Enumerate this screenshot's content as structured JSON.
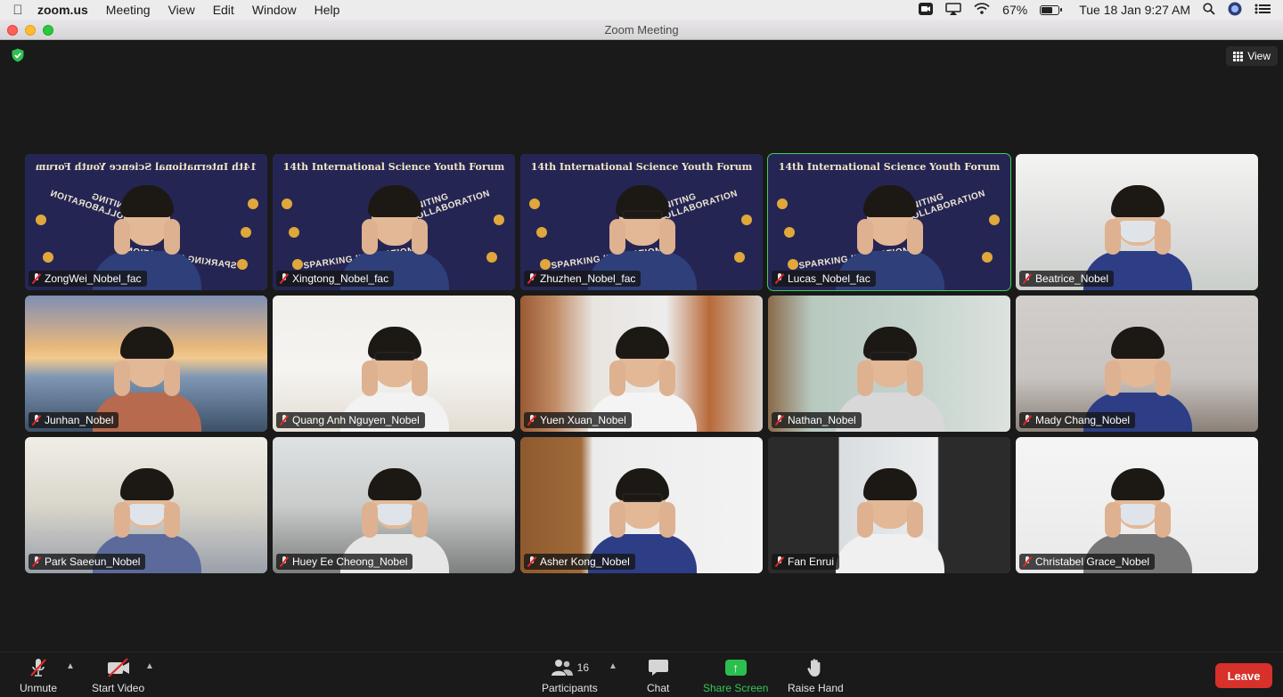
{
  "menubar": {
    "app_name": "zoom.us",
    "menus": [
      "Meeting",
      "View",
      "Edit",
      "Window",
      "Help"
    ],
    "battery_percent": "67%",
    "battery_level": 0.67,
    "datetime": "Tue 18 Jan  9:27 AM"
  },
  "window": {
    "title": "Zoom Meeting"
  },
  "meeting": {
    "view_label": "View",
    "banner": {
      "title": "14th International Science Youth Forum",
      "text_igniting": "IGNITING COLLABORATION",
      "text_sparking": "SPARKING INNOVATION"
    },
    "participants": [
      {
        "name": "ZongWei_Nobel_fac",
        "scene": "banner-mirror",
        "active": false
      },
      {
        "name": "Xingtong_Nobel_fac",
        "scene": "banner",
        "active": false
      },
      {
        "name": "Zhuzhen_Nobel_fac",
        "scene": "banner",
        "active": false
      },
      {
        "name": "Lucas_Nobel_fac",
        "scene": "banner",
        "active": true
      },
      {
        "name": "Beatrice_Nobel",
        "scene": "office",
        "active": false
      },
      {
        "name": "Junhan_Nobel",
        "scene": "bridge",
        "active": false
      },
      {
        "name": "Quang Anh Nguyen_Nobel",
        "scene": "white-room",
        "active": false
      },
      {
        "name": "Yuen Xuan_Nobel",
        "scene": "kitchen",
        "active": false
      },
      {
        "name": "Nathan_Nobel",
        "scene": "green-room",
        "active": false
      },
      {
        "name": "Mady Chang_Nobel",
        "scene": "grey-room",
        "active": false
      },
      {
        "name": "Park Saeeun_Nobel",
        "scene": "lab",
        "active": false
      },
      {
        "name": "Huey Ee Cheong_Nobel",
        "scene": "lab2",
        "active": false
      },
      {
        "name": "Asher Kong_Nobel",
        "scene": "door-room",
        "active": false
      },
      {
        "name": "Fan Enrui",
        "scene": "phone",
        "active": false
      },
      {
        "name": "Christabel Grace_Nobel",
        "scene": "wall-art",
        "active": false
      }
    ]
  },
  "toolbar": {
    "unmute_label": "Unmute",
    "start_video_label": "Start Video",
    "participants_label": "Participants",
    "participants_count": "16",
    "chat_label": "Chat",
    "share_screen_label": "Share Screen",
    "raise_hand_label": "Raise Hand",
    "leave_label": "Leave"
  },
  "colors": {
    "active_speaker": "#3fcf5b",
    "share_green": "#2bbf4f",
    "leave_red": "#d8302a"
  }
}
